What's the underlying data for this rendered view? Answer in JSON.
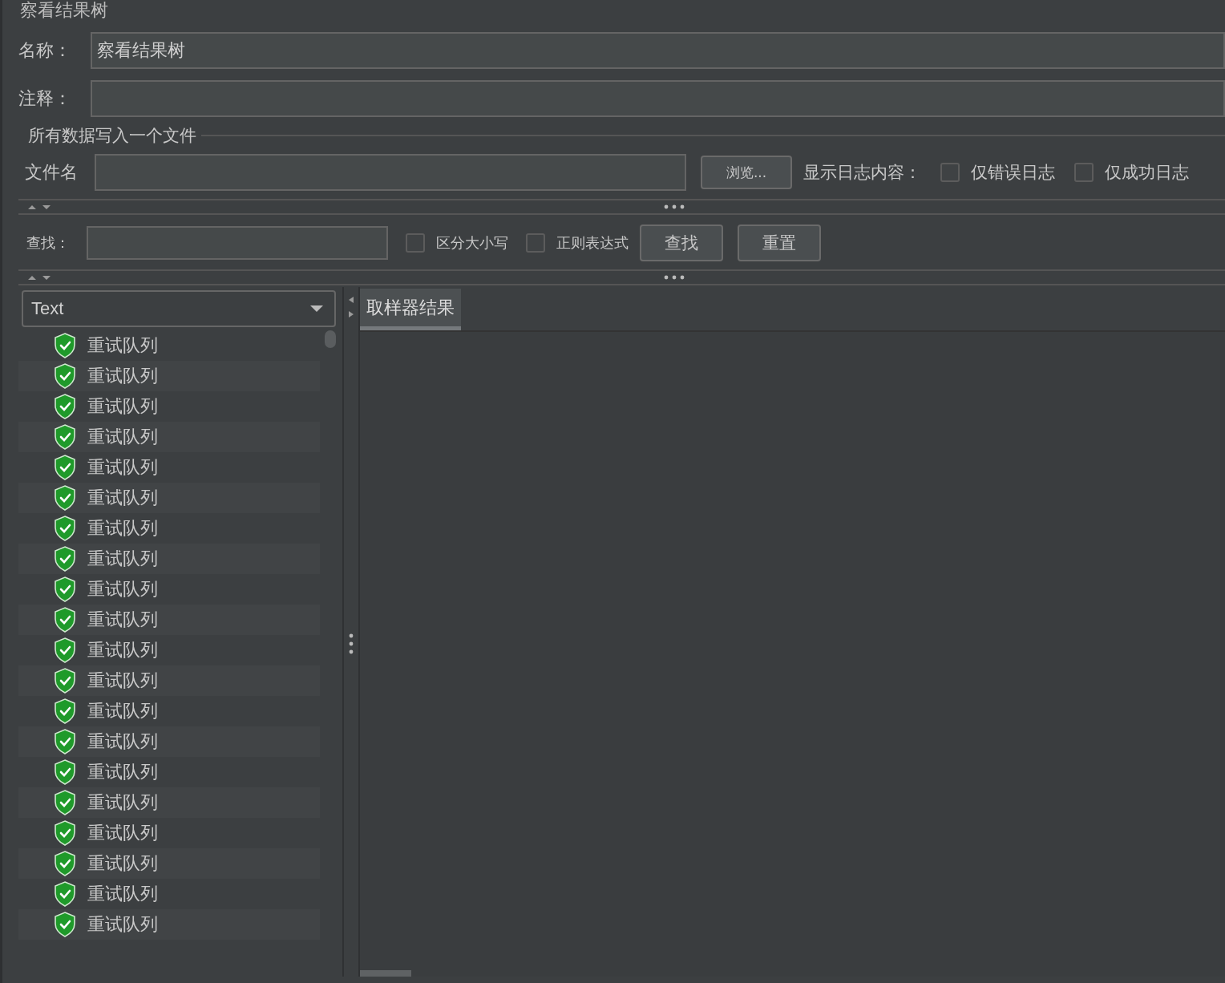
{
  "title": "察看结果树",
  "name_field": {
    "label": "名称：",
    "value": "察看结果树"
  },
  "comment_field": {
    "label": "注释："
  },
  "file_group": {
    "title": "所有数据写入一个文件",
    "file_label": "文件名",
    "browse_button": "浏览...",
    "log_label": "显示日志内容：",
    "options": [
      {
        "label": "仅错误日志",
        "checked": false
      },
      {
        "label": "仅成功日志",
        "checked": false
      }
    ]
  },
  "search": {
    "label": "查找：",
    "options": [
      {
        "label": "区分大小写",
        "checked": false
      },
      {
        "label": "正则表达式",
        "checked": false
      }
    ],
    "buttons": [
      "查找",
      "重置"
    ]
  },
  "renderer": {
    "value": "Text"
  },
  "results": [
    {
      "label": "重试队列",
      "success": true
    },
    {
      "label": "重试队列",
      "success": true
    },
    {
      "label": "重试队列",
      "success": true
    },
    {
      "label": "重试队列",
      "success": true
    },
    {
      "label": "重试队列",
      "success": true
    },
    {
      "label": "重试队列",
      "success": true
    },
    {
      "label": "重试队列",
      "success": true
    },
    {
      "label": "重试队列",
      "success": true
    },
    {
      "label": "重试队列",
      "success": true
    },
    {
      "label": "重试队列",
      "success": true
    },
    {
      "label": "重试队列",
      "success": true
    },
    {
      "label": "重试队列",
      "success": true
    },
    {
      "label": "重试队列",
      "success": true
    },
    {
      "label": "重试队列",
      "success": true
    },
    {
      "label": "重试队列",
      "success": true
    },
    {
      "label": "重试队列",
      "success": true
    },
    {
      "label": "重试队列",
      "success": true
    },
    {
      "label": "重试队列",
      "success": true
    },
    {
      "label": "重试队列",
      "success": true
    },
    {
      "label": "重试队列",
      "success": true
    }
  ],
  "tabs": [
    {
      "label": "取样器结果",
      "selected": true
    }
  ]
}
